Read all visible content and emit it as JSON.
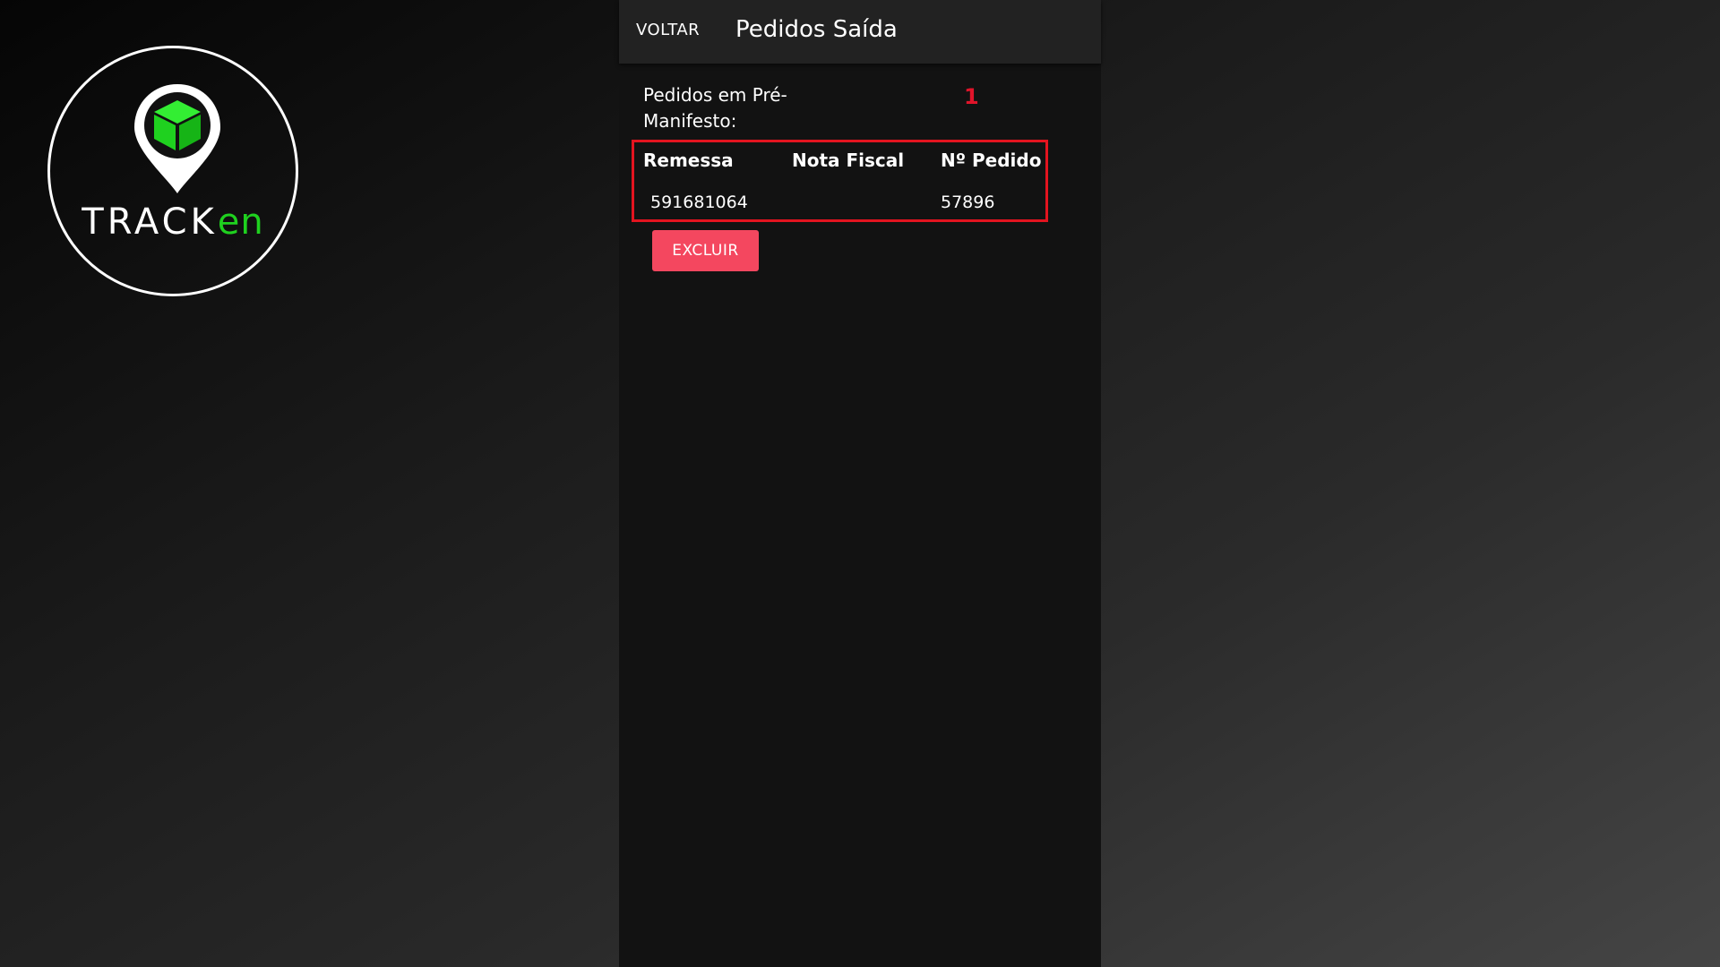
{
  "logo": {
    "text_track": "TRACK",
    "text_en": "en",
    "icon": "location-pin-cube-icon",
    "accent_color": "#1fd11f"
  },
  "appbar": {
    "back_label": "VOLTAR",
    "title": "Pedidos Saída",
    "background": "#222222"
  },
  "section": {
    "label": "Pedidos em Pré-Manifesto:",
    "count": "1",
    "count_color": "#e0142a"
  },
  "table": {
    "headers": {
      "remessa": "Remessa",
      "nota_fiscal": "Nota Fiscal",
      "pedido": "Nº Pedido"
    },
    "rows": [
      {
        "remessa": "591681064",
        "nota_fiscal": "",
        "pedido": "57896"
      }
    ],
    "highlight_color": "#e3141f"
  },
  "actions": {
    "delete_label": "EXCLUIR",
    "delete_color": "#f4475f"
  }
}
